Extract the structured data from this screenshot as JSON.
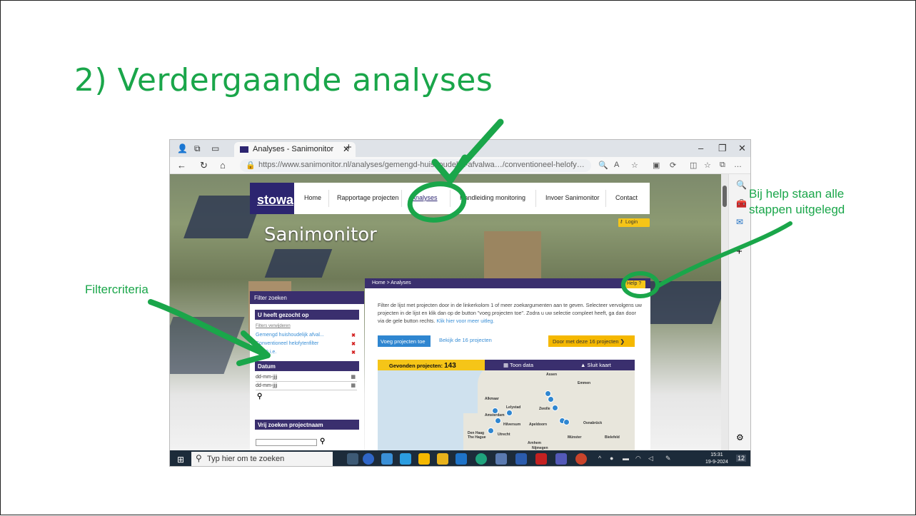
{
  "slide": {
    "title": "2) Verdergaande analyses",
    "annotation_help": "Bij help staan alle stappen uitgelegd",
    "annotation_filter": "Filtercriteria",
    "accent_color": "#1aa64a"
  },
  "browser": {
    "tab_title": "Analyses - Sanimonitor",
    "url_host": "https://www.sanimonitor.nl",
    "url_path": "/analyses/gemengd-huishoudelijk-afvalwa…/conventioneel-helofy…",
    "new_tab": "+",
    "min": "–",
    "max": "❐",
    "close": "✕"
  },
  "site": {
    "logo": "stowa",
    "menu": [
      "Home",
      "Rapportage projecten",
      "Analyses",
      "Handleiding monitoring",
      "Invoer Sanimonitor",
      "Contact"
    ],
    "login": "Login",
    "brand": "Sanimonitor",
    "breadcrumb": "Home  >  Analyses",
    "help": "Help ?",
    "brand_color": "#2c2570",
    "yellow": "#f5c518"
  },
  "filter": {
    "header": "Filter zoeken",
    "searched_header": "U heeft gezocht op",
    "remove_filters": "Filters verwijderen",
    "items": [
      "Gemengd huishoudelijk afval...",
      "Conventioneel helofytenfilter",
      "1 - 10 i.e."
    ],
    "remove_icon": "✖",
    "date_header": "Datum",
    "date_placeholder_1": "dd-mm-jjjj",
    "date_placeholder_2": "dd-mm-jjjj",
    "name_header": "Vrij zoeken projectnaam"
  },
  "main": {
    "intro": "Filter de lijst met projecten door in de linkerkolom 1 of meer zoekargumenten aan te geven. Selecteer vervolgens uw projecten in de lijst en klik dan op de button \"voeg projecten toe\". Zodra u uw selectie compleet heeft, ga dan door via de gele button rechts.",
    "intro_link": "Klik hier voor meer uitleg.",
    "add_button": "Voeg projecten toe",
    "view_link": "Bekijk de 16 projecten",
    "continue_button": "Door met deze 16 projecten",
    "found_label": "Gevonden projecten:",
    "found_count": "143",
    "show_data": "Toon data",
    "close_map": "Sluit kaart",
    "map_cities": [
      "Assen",
      "Emmen",
      "Alkmaar",
      "Lelystad",
      "Zwolle",
      "Amsterdam",
      "Hilversum",
      "Apeldoorn",
      "Osnabrück",
      "Den Haag",
      "The Hague",
      "Utrecht",
      "Münster",
      "Bielefeld",
      "Arnhem",
      "Nijmegen"
    ]
  },
  "taskbar": {
    "search_placeholder": "Typ hier om te zoeken",
    "time": "15:31",
    "date": "19-9-2024",
    "notifications": "12"
  }
}
